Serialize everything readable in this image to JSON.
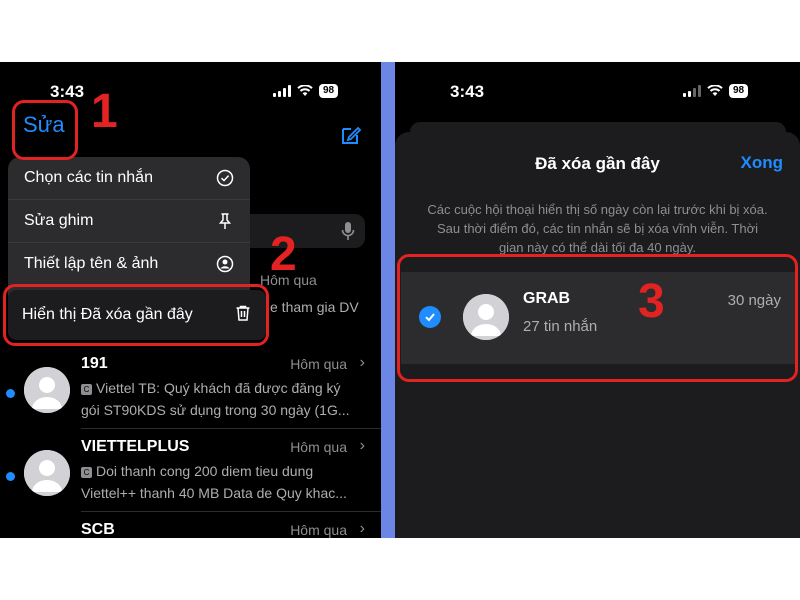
{
  "left": {
    "time": "3:43",
    "battery": "98",
    "edit_label": "Sửa",
    "menu": [
      {
        "label": "Chọn các tin nhắn",
        "icon": "checkmark-circle-icon"
      },
      {
        "label": "Sửa ghim",
        "icon": "pin-icon"
      },
      {
        "label": "Thiết lập tên & ảnh",
        "icon": "person-circle-icon"
      },
      {
        "label": "Hiển thị Đã xóa gần đây",
        "icon": "trash-icon"
      }
    ],
    "partial_row": {
      "time": "Hôm qua",
      "preview": "e tham gia DV"
    },
    "messages": [
      {
        "name": "191",
        "time": "Hôm qua",
        "line1": "Viettel TB: Quý khách đã được đăng ký",
        "line2": "gói ST90KDS sử dụng trong 30 ngày (1G..."
      },
      {
        "name": "VIETTELPLUS",
        "time": "Hôm qua",
        "line1": "Doi thanh cong 200 diem tieu dung",
        "line2": "Viettel++ thanh 40 MB Data de Quy khac..."
      },
      {
        "name": "SCB",
        "time": "Hôm qua",
        "line1": "",
        "line2": ""
      }
    ],
    "annotations": [
      "1",
      "2"
    ]
  },
  "right": {
    "time": "3:43",
    "battery": "98",
    "title": "Đã xóa gần đây",
    "done_label": "Xong",
    "note": "Các cuộc hội thoại hiển thị số ngày còn lại trước khi bị xóa. Sau thời điểm đó, các tin nhắn sẽ bị xóa vĩnh viễn. Thời gian này có thể dài tối đa 40 ngày.",
    "row": {
      "name": "GRAB",
      "count": "27 tin nhắn",
      "days": "30 ngày"
    },
    "annotation": "3"
  },
  "colors": {
    "accent": "#1f8cff",
    "annotation": "#e32222",
    "divider": "#6c86e6"
  }
}
